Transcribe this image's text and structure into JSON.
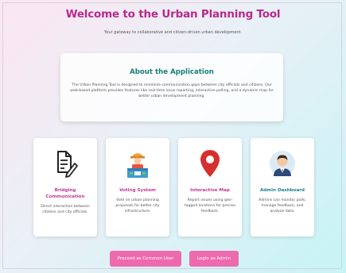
{
  "header": {
    "title": "Welcome to the Urban Planning Tool",
    "subtitle": "Your gateway to collaborative and citizen-driven urban development."
  },
  "about": {
    "heading": "About the Application",
    "text": "The Urban Planning Tool is designed to minimize communication gaps between city officials and citizens. Our web-based platform provides features like real-time issue reporting, interactive polling, and a dynamic map for better urban development planning."
  },
  "features": [
    {
      "icon": "document-pencil-icon",
      "title": "Bridging Communication",
      "text": "Direct interaction between citizens and city officials."
    },
    {
      "icon": "voting-person-icon",
      "title": "Voting System",
      "text": "Vote on urban planning proposals for better city infrastructure."
    },
    {
      "icon": "map-pin-icon",
      "title": "Interactive Map",
      "text": "Report issues using geo-tagged locations for precise feedback."
    },
    {
      "icon": "admin-user-icon",
      "title": "Admin Dashboard",
      "text": "Admins can monitor polls, manage feedback, and analyze data."
    }
  ],
  "actions": {
    "common_user": "Proceed as Common User",
    "admin": "Login as Admin"
  },
  "colors": {
    "title": "#b62a8c",
    "about_heading": "#147f79",
    "button": "#ee6aae"
  }
}
